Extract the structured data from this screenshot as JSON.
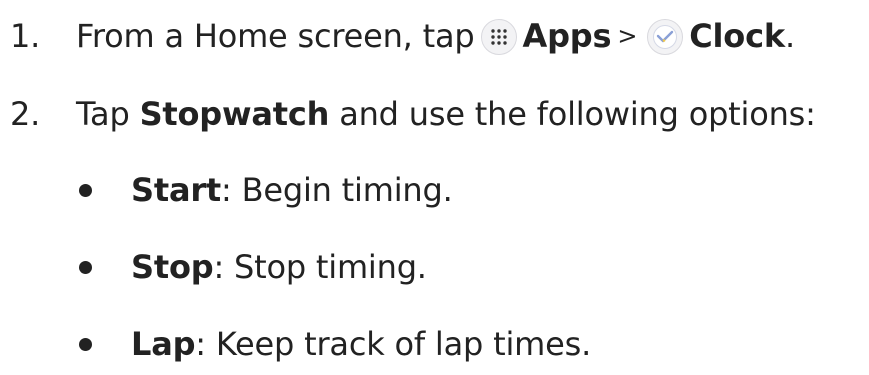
{
  "steps": [
    {
      "number": "1.",
      "prefix": "From a Home screen, tap",
      "apps_icon": "apps-grid-icon",
      "apps_label": "Apps",
      "separator": ">",
      "clock_icon": "clock-icon",
      "clock_label": "Clock",
      "suffix": "."
    },
    {
      "number": "2.",
      "prefix": "Tap",
      "bold": "Stopwatch",
      "suffix": "and use the following options:"
    }
  ],
  "options": [
    {
      "label": "Start",
      "text": ": Begin timing."
    },
    {
      "label": "Stop",
      "text": ": Stop timing."
    },
    {
      "label": "Lap",
      "text": ": Keep track of lap times."
    }
  ],
  "colors": {
    "text": "#222222",
    "icon_bg": "#f3f3f5",
    "clock_hands": "#8aa0d6",
    "clock_accent": "#f2c94c"
  }
}
